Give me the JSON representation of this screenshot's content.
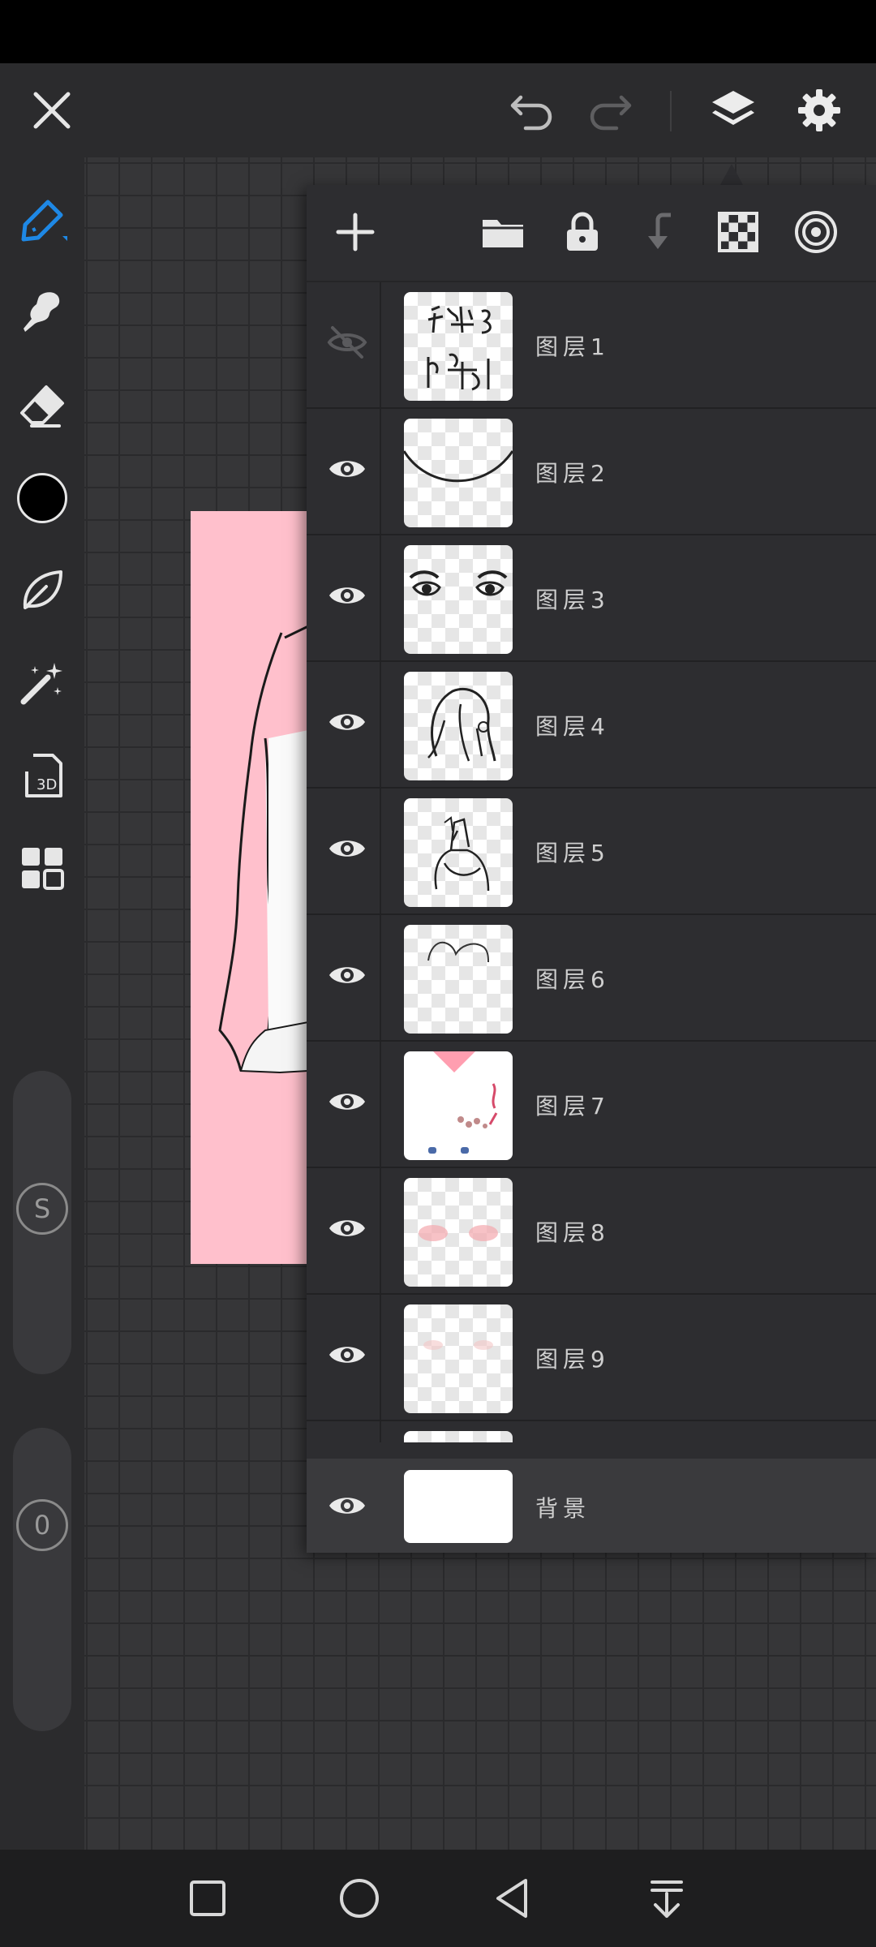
{
  "top_bar": {
    "close_icon": "close-icon",
    "undo_icon": "undo-icon",
    "redo_icon": "redo-icon",
    "layers_icon": "layers-icon",
    "settings_icon": "gear-icon"
  },
  "tools": [
    {
      "name": "brush-tool",
      "icon": "pen-icon",
      "active": true
    },
    {
      "name": "smudge-tool",
      "icon": "smudge-icon"
    },
    {
      "name": "eraser-tool",
      "icon": "eraser-icon"
    },
    {
      "name": "color-picker",
      "icon": "color-swatch",
      "color": "#000000"
    },
    {
      "name": "leaf-tool",
      "icon": "leaf-icon"
    },
    {
      "name": "magic-wand-tool",
      "icon": "magic-wand-icon"
    },
    {
      "name": "3d-tool",
      "icon": "3d-icon",
      "label": "3D"
    },
    {
      "name": "gallery-tool",
      "icon": "grid-icon"
    }
  ],
  "sliders": {
    "size_label": "S",
    "opacity_label": "0"
  },
  "layers_toolbar": {
    "add_icon": "plus-icon",
    "folder_icon": "folder-icon",
    "lock_icon": "lock-icon",
    "merge_down_icon": "merge-down-icon",
    "alpha_lock_icon": "checker-icon",
    "blend_icon": "target-icon"
  },
  "layers": [
    {
      "name": "图层1",
      "visible": false
    },
    {
      "name": "图层2",
      "visible": true
    },
    {
      "name": "图层3",
      "visible": true
    },
    {
      "name": "图层4",
      "visible": true
    },
    {
      "name": "图层5",
      "visible": true
    },
    {
      "name": "图层6",
      "visible": true
    },
    {
      "name": "图层7",
      "visible": true
    },
    {
      "name": "图层8",
      "visible": true
    },
    {
      "name": "图层9",
      "visible": true
    }
  ],
  "background_layer": {
    "name": "背景",
    "visible": true
  },
  "colors": {
    "accent": "#1e88e5",
    "canvas_pink": "#ffc0cc",
    "panel": "#2d2d30"
  },
  "nav": {
    "recents_icon": "square-icon",
    "home_icon": "circle-icon",
    "back_icon": "triangle-back-icon",
    "notifications_icon": "pull-down-icon"
  }
}
